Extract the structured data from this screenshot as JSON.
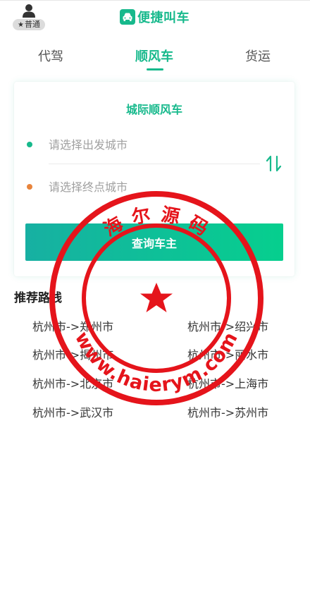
{
  "header": {
    "user_level": "普通",
    "brand_name": "便捷叫车"
  },
  "tabs": [
    {
      "label": "代驾"
    },
    {
      "label": "顺风车"
    },
    {
      "label": "货运"
    }
  ],
  "card": {
    "title": "城际顺风车",
    "from_placeholder": "请选择出发城市",
    "to_placeholder": "请选择终点城市",
    "search_button": "查询车主"
  },
  "recommended": {
    "title": "推荐路线",
    "routes": [
      {
        "label": "杭州市->郑州市"
      },
      {
        "label": "杭州市->绍兴市"
      },
      {
        "label": "杭州市->揭州市"
      },
      {
        "label": "杭州市->丽水市"
      },
      {
        "label": "杭州市->北京市"
      },
      {
        "label": "杭州市->上海市"
      },
      {
        "label": "杭州市->武汉市"
      },
      {
        "label": "杭州市->苏州市"
      }
    ]
  },
  "watermark": {
    "top_text": "海 尔 源 码",
    "bottom_text": "www.haierym.com",
    "color": "#e5141b"
  },
  "colors": {
    "accent": "#17b98c",
    "start_dot": "#17b98c",
    "end_dot": "#e8843c"
  }
}
